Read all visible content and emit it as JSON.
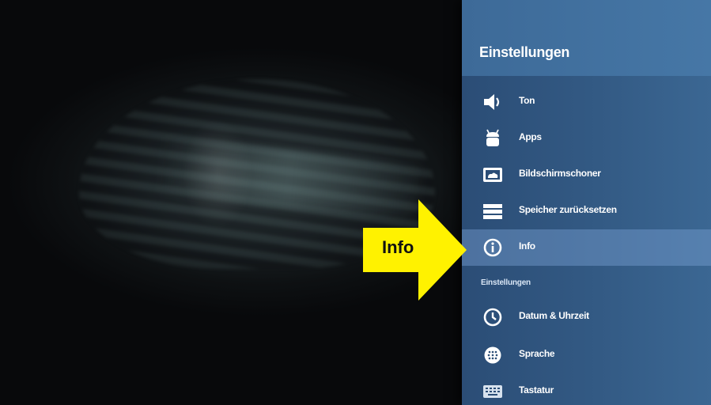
{
  "panel": {
    "title": "Einstellungen",
    "items": [
      {
        "label": "Ton",
        "icon": "speaker-icon"
      },
      {
        "label": "Apps",
        "icon": "android-icon"
      },
      {
        "label": "Bildschirmschoner",
        "icon": "screensaver-icon"
      },
      {
        "label": "Speicher zurücksetzen",
        "icon": "storage-reset-icon"
      },
      {
        "label": "Info",
        "icon": "info-icon",
        "selected": true
      }
    ],
    "section_header": "Einstellungen",
    "section_items": [
      {
        "label": "Datum & Uhrzeit",
        "icon": "clock-icon"
      },
      {
        "label": "Sprache",
        "icon": "globe-icon"
      },
      {
        "label": "Tastatur",
        "icon": "keyboard-icon"
      }
    ]
  },
  "annotation": {
    "label": "Info",
    "color": "#fff200"
  },
  "colors": {
    "panel_bg": "#335a84",
    "header_bg": "#4677a6",
    "selected_bg": "#5b82ad"
  }
}
